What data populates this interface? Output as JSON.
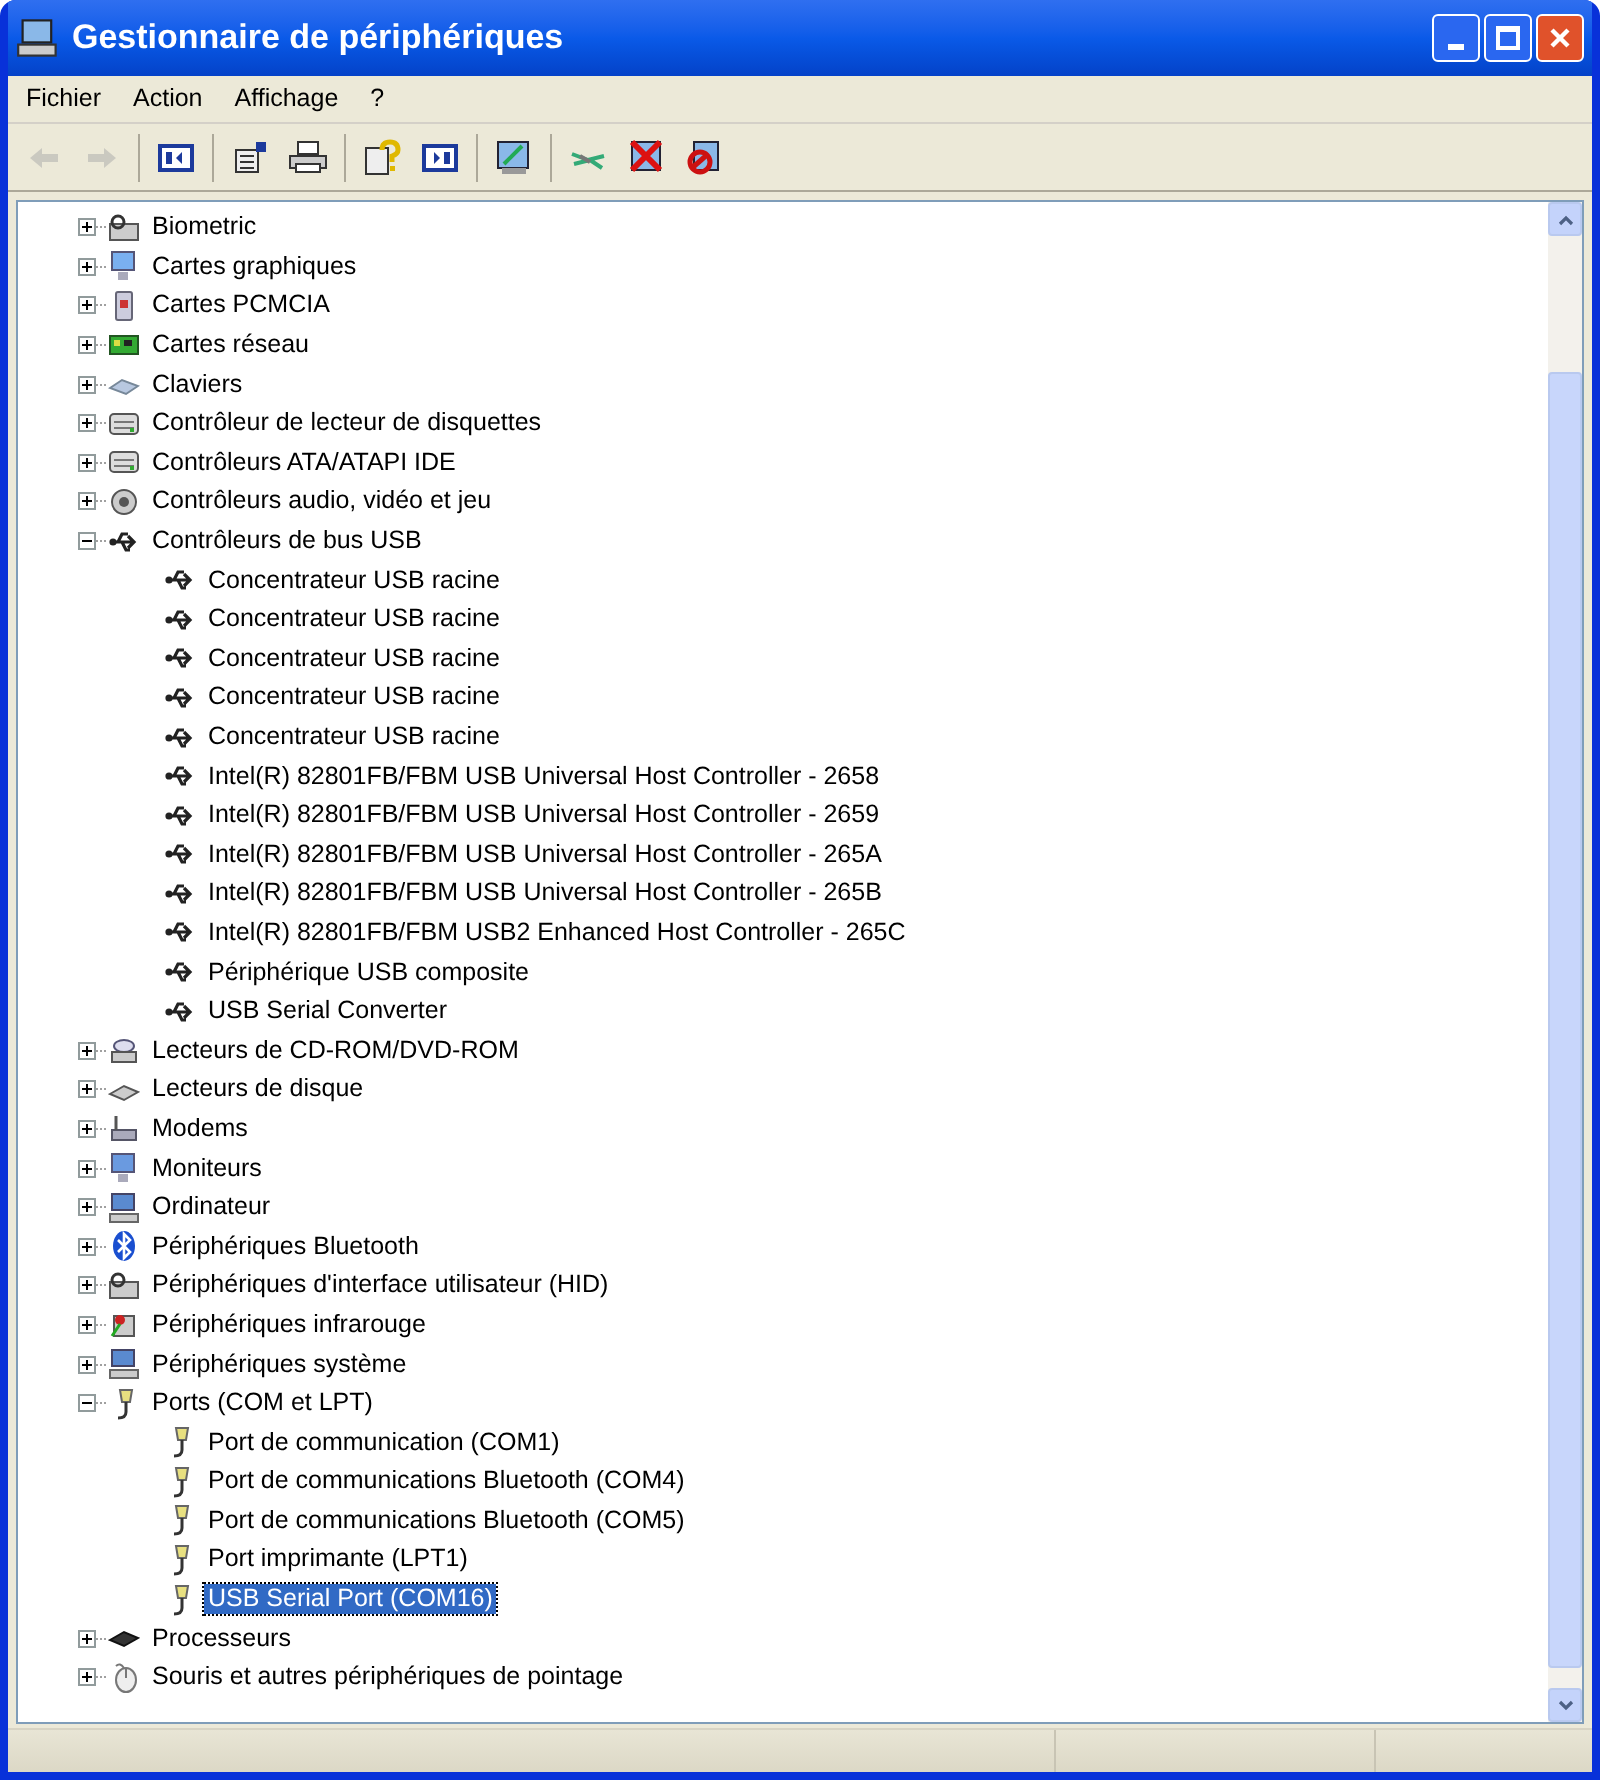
{
  "window": {
    "title": "Gestionnaire de périphériques"
  },
  "menu": [
    "Fichier",
    "Action",
    "Affichage",
    "?"
  ],
  "toolbar": [
    {
      "kind": "back",
      "disabled": true
    },
    {
      "kind": "forward",
      "disabled": true
    },
    {
      "kind": "sep"
    },
    {
      "kind": "tree",
      "disabled": false
    },
    {
      "kind": "sep"
    },
    {
      "kind": "properties",
      "disabled": false
    },
    {
      "kind": "print",
      "disabled": false
    },
    {
      "kind": "sep"
    },
    {
      "kind": "help",
      "disabled": false
    },
    {
      "kind": "pane",
      "disabled": false
    },
    {
      "kind": "sep"
    },
    {
      "kind": "scan",
      "disabled": false
    },
    {
      "kind": "sep"
    },
    {
      "kind": "update",
      "disabled": false
    },
    {
      "kind": "uninstall",
      "disabled": false
    },
    {
      "kind": "disable",
      "disabled": false
    }
  ],
  "tree": [
    {
      "label": "Biometric",
      "kind": "biometric",
      "expanded": false,
      "selected": false
    },
    {
      "label": "Cartes graphiques",
      "kind": "display",
      "expanded": false,
      "selected": false
    },
    {
      "label": "Cartes PCMCIA",
      "kind": "pcmcia",
      "expanded": false,
      "selected": false
    },
    {
      "label": "Cartes réseau",
      "kind": "network",
      "expanded": false,
      "selected": false
    },
    {
      "label": "Claviers",
      "kind": "keyboard",
      "expanded": false,
      "selected": false
    },
    {
      "label": "Contrôleur de lecteur de disquettes",
      "kind": "drive",
      "expanded": false,
      "selected": false
    },
    {
      "label": "Contrôleurs ATA/ATAPI IDE",
      "kind": "drive",
      "expanded": false,
      "selected": false
    },
    {
      "label": "Contrôleurs audio, vidéo et jeu",
      "kind": "audio",
      "expanded": false,
      "selected": false
    },
    {
      "label": "Contrôleurs de bus USB",
      "kind": "usb",
      "expanded": true,
      "selected": false,
      "children": [
        {
          "label": "Concentrateur USB racine",
          "kind": "usb",
          "selected": false
        },
        {
          "label": "Concentrateur USB racine",
          "kind": "usb",
          "selected": false
        },
        {
          "label": "Concentrateur USB racine",
          "kind": "usb",
          "selected": false
        },
        {
          "label": "Concentrateur USB racine",
          "kind": "usb",
          "selected": false
        },
        {
          "label": "Concentrateur USB racine",
          "kind": "usb",
          "selected": false
        },
        {
          "label": "Intel(R) 82801FB/FBM USB Universal Host Controller - 2658",
          "kind": "usb",
          "selected": false
        },
        {
          "label": "Intel(R) 82801FB/FBM USB Universal Host Controller - 2659",
          "kind": "usb",
          "selected": false
        },
        {
          "label": "Intel(R) 82801FB/FBM USB Universal Host Controller - 265A",
          "kind": "usb",
          "selected": false
        },
        {
          "label": "Intel(R) 82801FB/FBM USB Universal Host Controller - 265B",
          "kind": "usb",
          "selected": false
        },
        {
          "label": "Intel(R) 82801FB/FBM USB2 Enhanced Host Controller - 265C",
          "kind": "usb",
          "selected": false
        },
        {
          "label": "Périphérique USB composite",
          "kind": "usb",
          "selected": false
        },
        {
          "label": "USB Serial Converter",
          "kind": "usb",
          "selected": false
        }
      ]
    },
    {
      "label": "Lecteurs de CD-ROM/DVD-ROM",
      "kind": "cdrom",
      "expanded": false,
      "selected": false
    },
    {
      "label": "Lecteurs de disque",
      "kind": "disk",
      "expanded": false,
      "selected": false
    },
    {
      "label": "Modems",
      "kind": "modem",
      "expanded": false,
      "selected": false
    },
    {
      "label": "Moniteurs",
      "kind": "monitor",
      "expanded": false,
      "selected": false
    },
    {
      "label": "Ordinateur",
      "kind": "computer",
      "expanded": false,
      "selected": false
    },
    {
      "label": "Périphériques Bluetooth",
      "kind": "bluetooth",
      "expanded": false,
      "selected": false
    },
    {
      "label": "Périphériques d'interface utilisateur (HID)",
      "kind": "biometric",
      "expanded": false,
      "selected": false
    },
    {
      "label": "Périphériques infrarouge",
      "kind": "infrared",
      "expanded": false,
      "selected": false
    },
    {
      "label": "Périphériques système",
      "kind": "computer",
      "expanded": false,
      "selected": false
    },
    {
      "label": "Ports (COM et LPT)",
      "kind": "port",
      "expanded": true,
      "selected": false,
      "children": [
        {
          "label": "Port de communication (COM1)",
          "kind": "port",
          "selected": false
        },
        {
          "label": "Port de communications Bluetooth (COM4)",
          "kind": "port",
          "selected": false
        },
        {
          "label": "Port de communications Bluetooth (COM5)",
          "kind": "port",
          "selected": false
        },
        {
          "label": "Port imprimante (LPT1)",
          "kind": "port",
          "selected": false
        },
        {
          "label": "USB Serial Port (COM16)",
          "kind": "port",
          "selected": true
        }
      ]
    },
    {
      "label": "Processeurs",
      "kind": "processor",
      "expanded": false,
      "selected": false
    },
    {
      "label": "Souris et autres périphériques de pointage",
      "kind": "mouse",
      "expanded": false,
      "selected": false
    }
  ]
}
